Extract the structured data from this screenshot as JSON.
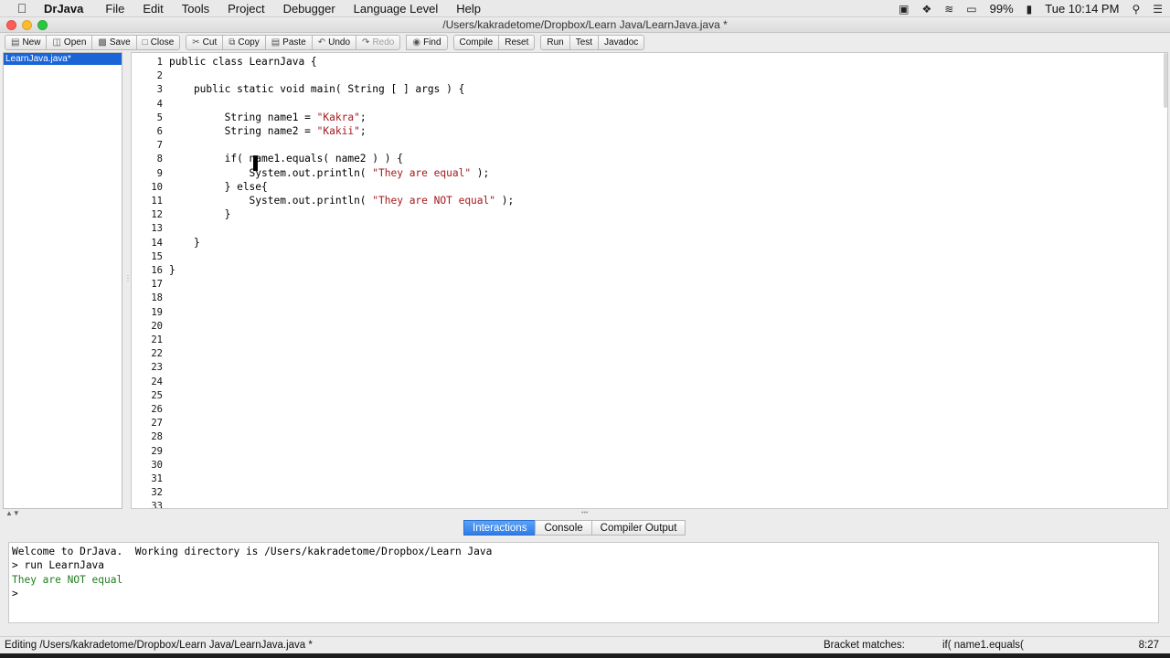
{
  "menubar": {
    "app": "DrJava",
    "items": [
      "File",
      "Edit",
      "Tools",
      "Project",
      "Debugger",
      "Language Level",
      "Help"
    ],
    "battery": "99%",
    "clock": "Tue 10:14 PM"
  },
  "window": {
    "title": "/Users/kakradetome/Dropbox/Learn Java/LearnJava.java *"
  },
  "toolbar": {
    "new": "New",
    "open": "Open",
    "save": "Save",
    "close": "Close",
    "cut": "Cut",
    "copy": "Copy",
    "paste": "Paste",
    "undo": "Undo",
    "redo": "Redo",
    "find": "Find",
    "compile": "Compile",
    "reset": "Reset",
    "run": "Run",
    "test": "Test",
    "javadoc": "Javadoc"
  },
  "files": [
    "LearnJava.java*"
  ],
  "editor": {
    "line_numbers": [
      "1",
      "2",
      "3",
      "4",
      "5",
      "6",
      "7",
      "8",
      "9",
      "10",
      "11",
      "12",
      "13",
      "14",
      "15",
      "16",
      "17",
      "18",
      "19",
      "20",
      "21",
      "22",
      "23",
      "24",
      "25",
      "26",
      "27",
      "28",
      "29",
      "30",
      "31",
      "32",
      "33"
    ],
    "lines": [
      "public class LearnJava {",
      "",
      "    public static void main( String [ ] args ) {",
      "",
      "         String name1 = \"Kakra\";",
      "         String name2 = \"Kakii\";",
      "",
      "         if( name1.equals( name2 ) ) {",
      "             System.out.println( \"They are equal\" );",
      "         } else{",
      "             System.out.println( \"They are NOT equal\" );",
      "         }",
      "",
      "    }",
      "",
      "}"
    ]
  },
  "tabs": [
    "Interactions",
    "Console",
    "Compiler Output"
  ],
  "console": {
    "welcome": "Welcome to DrJava.  Working directory is /Users/kakradetome/Dropbox/Learn Java",
    "command": "> run LearnJava",
    "output": "They are NOT equal",
    "prompt": ">"
  },
  "status": {
    "editing": "Editing /Users/kakradetome/Dropbox/Learn Java/LearnJava.java *",
    "bracket_label": "Bracket matches:",
    "bracket_value": "if( name1.equals(",
    "position": "8:27"
  }
}
